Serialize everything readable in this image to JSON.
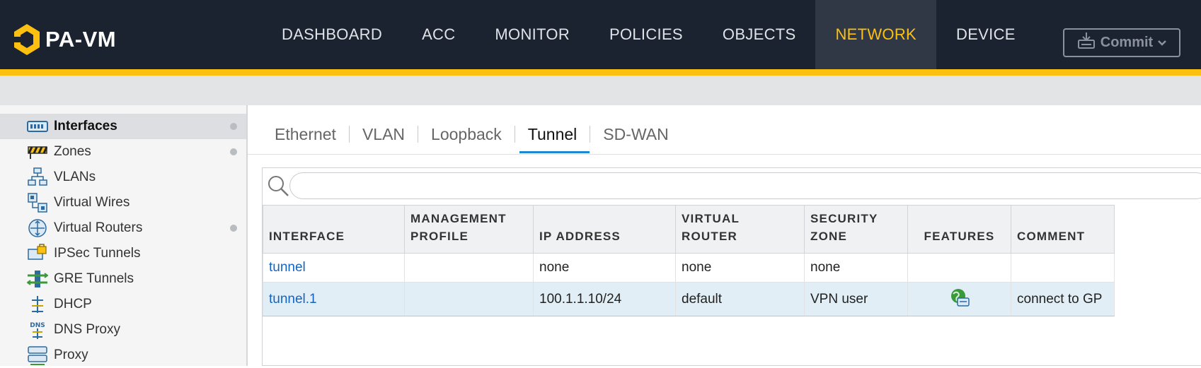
{
  "app": {
    "name": "PA-VM"
  },
  "nav": {
    "items": [
      {
        "label": "DASHBOARD"
      },
      {
        "label": "ACC"
      },
      {
        "label": "MONITOR"
      },
      {
        "label": "POLICIES"
      },
      {
        "label": "OBJECTS"
      },
      {
        "label": "NETWORK"
      },
      {
        "label": "DEVICE"
      }
    ],
    "active": "NETWORK",
    "commit_label": "Commit",
    "accent_color": "#fcc011"
  },
  "sidebar": {
    "items": [
      {
        "label": "Interfaces",
        "icon": "interfaces-icon",
        "active": true,
        "dot": true
      },
      {
        "label": "Zones",
        "icon": "zones-icon",
        "dot": true
      },
      {
        "label": "VLANs",
        "icon": "vlans-icon"
      },
      {
        "label": "Virtual Wires",
        "icon": "virtual-wires-icon"
      },
      {
        "label": "Virtual Routers",
        "icon": "virtual-routers-icon",
        "dot": true
      },
      {
        "label": "IPSec Tunnels",
        "icon": "ipsec-tunnels-icon"
      },
      {
        "label": "GRE Tunnels",
        "icon": "gre-tunnels-icon"
      },
      {
        "label": "DHCP",
        "icon": "dhcp-icon"
      },
      {
        "label": "DNS Proxy",
        "icon": "dns-proxy-icon"
      },
      {
        "label": "Proxy",
        "icon": "proxy-icon"
      }
    ]
  },
  "tabs": {
    "items": [
      {
        "label": "Ethernet"
      },
      {
        "label": "VLAN"
      },
      {
        "label": "Loopback"
      },
      {
        "label": "Tunnel"
      },
      {
        "label": "SD-WAN"
      }
    ],
    "active": "Tunnel"
  },
  "search": {
    "value": "",
    "placeholder": ""
  },
  "table": {
    "columns": [
      {
        "label": "INTERFACE"
      },
      {
        "label": "MANAGEMENT PROFILE"
      },
      {
        "label": "IP ADDRESS"
      },
      {
        "label": "VIRTUAL ROUTER"
      },
      {
        "label": "SECURITY ZONE"
      },
      {
        "label": "FEATURES"
      },
      {
        "label": "COMMENT"
      }
    ],
    "rows": [
      {
        "interface": "tunnel",
        "management_profile": "",
        "ip_address": "none",
        "virtual_router": "none",
        "security_zone": "none",
        "features": "",
        "comment": ""
      },
      {
        "interface": "tunnel.1",
        "management_profile": "",
        "ip_address": "100.1.1.10/24",
        "virtual_router": "default",
        "security_zone": "VPN user",
        "features": "globalprotect-feature-icon",
        "comment": "connect to GP"
      }
    ]
  }
}
